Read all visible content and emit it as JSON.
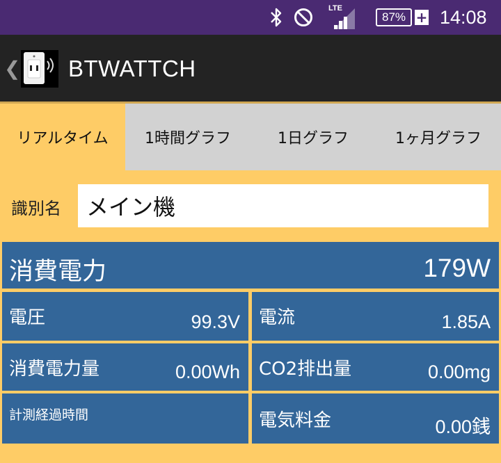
{
  "status_bar": {
    "network": "LTE",
    "battery": "87%",
    "time": "14:08",
    "icons": [
      "bluetooth-icon",
      "do-not-disturb-icon",
      "signal-icon",
      "battery-icon"
    ]
  },
  "app_bar": {
    "title": "BTWATTCH"
  },
  "tabs": [
    {
      "label": "リアルタイム",
      "active": true
    },
    {
      "label": "1時間グラフ",
      "active": false
    },
    {
      "label": "1日グラフ",
      "active": false
    },
    {
      "label": "1ヶ月グラフ",
      "active": false
    }
  ],
  "device": {
    "name_label": "識別名",
    "name_value": "メイン機"
  },
  "metrics": {
    "power": {
      "label": "消費電力",
      "value": "179W"
    },
    "voltage": {
      "label": "電圧",
      "value": "99.3V"
    },
    "current": {
      "label": "電流",
      "value": "1.85A"
    },
    "energy": {
      "label": "消費電力量",
      "value": "0.00Wh"
    },
    "co2": {
      "label": "CO2排出量",
      "value": "0.00mg"
    },
    "elapsed": {
      "label": "計測経過時間",
      "value": ""
    },
    "cost": {
      "label": "電気料金",
      "value": "0.00銭"
    }
  },
  "colors": {
    "status_bar": "#4a2a72",
    "app_bar": "#232323",
    "background": "#fecc66",
    "panel": "#336699",
    "inactive_tab": "#d2d2d2"
  }
}
